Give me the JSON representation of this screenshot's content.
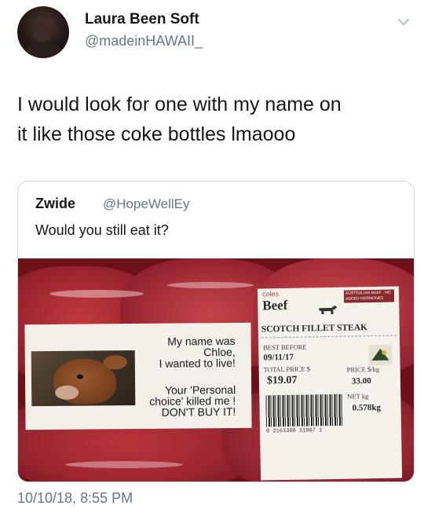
{
  "tweet": {
    "display_name": "Laura Been Soft",
    "handle": "@madeinHAWAII_",
    "text_lines": [
      "I would look for one with my name on",
      "it like those coke bottles lmaooo"
    ],
    "timestamp": "10/10/18, 8:55 PM"
  },
  "quoted_tweet": {
    "display_name": "Zwide",
    "handle": "@HopeWellEy",
    "text": "Would you still eat it?"
  },
  "photo": {
    "note_lines": [
      "My name was",
      "Chloe,",
      "I wanted to live!",
      "Your 'Personal",
      "choice' killed me !",
      "DON'T BUY IT!"
    ],
    "label": {
      "brand": "coles",
      "category": "Beef",
      "badge": "AUSTRALIAN BEEF · NO ADDED HORMONES",
      "product": "SCOTCH FILLET STEAK",
      "best_before_label": "BEST BEFORE",
      "best_before": "09/11/17",
      "total_price_label": "TOTAL PRICE $",
      "total_price": "$19.07",
      "price_per_kg_label": "PRICE $/kg",
      "price_per_kg": "33.00",
      "net_kg_label": "NET kg",
      "net_kg": "0.578kg",
      "barcode_digits": "0 2161300 11907 1"
    }
  },
  "colors": {
    "text_primary": "#14171a",
    "text_secondary": "#657786",
    "border": "#ccd6dd"
  },
  "icons": {
    "chevron": "chevron-down-icon"
  }
}
